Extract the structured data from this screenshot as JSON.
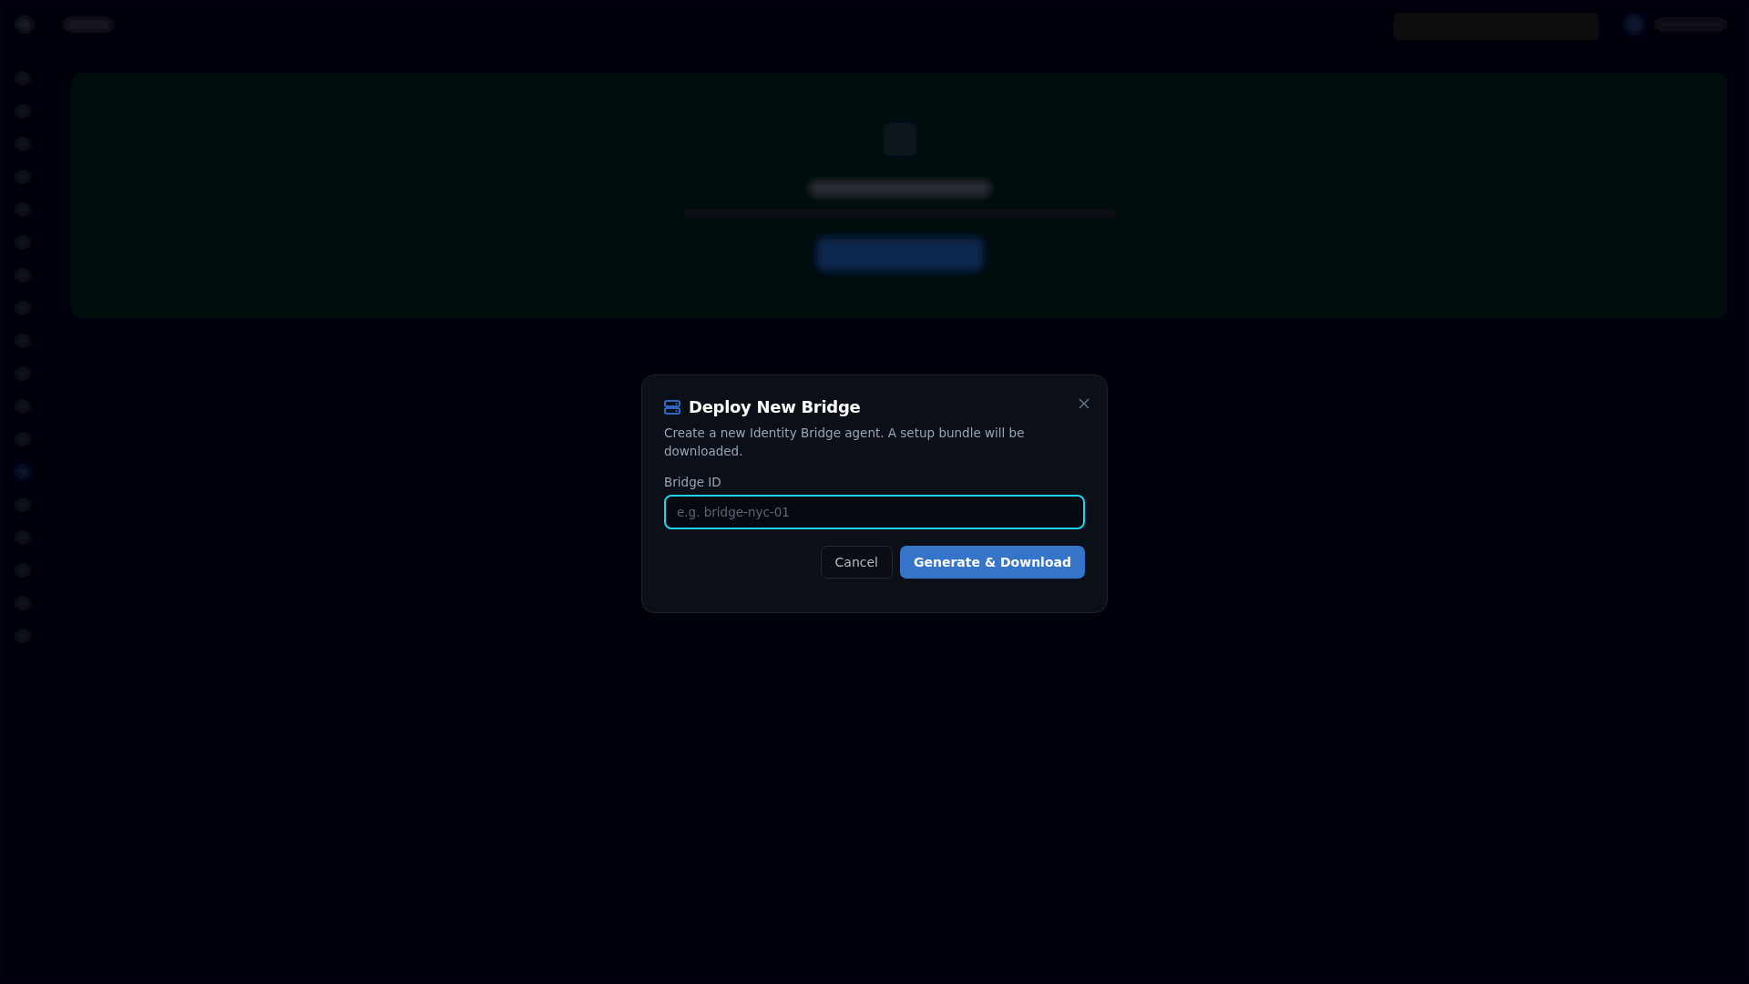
{
  "dialog": {
    "title": "Deploy New Bridge",
    "description": "Create a new Identity Bridge agent. A setup bundle will be downloaded.",
    "field": {
      "label": "Bridge ID",
      "placeholder": "e.g. bridge-nyc-01",
      "focused": true
    },
    "buttons": [
      {
        "label": "Cancel",
        "kind": "secondary"
      },
      {
        "label": "Generate & Download",
        "kind": "primary"
      }
    ]
  }
}
